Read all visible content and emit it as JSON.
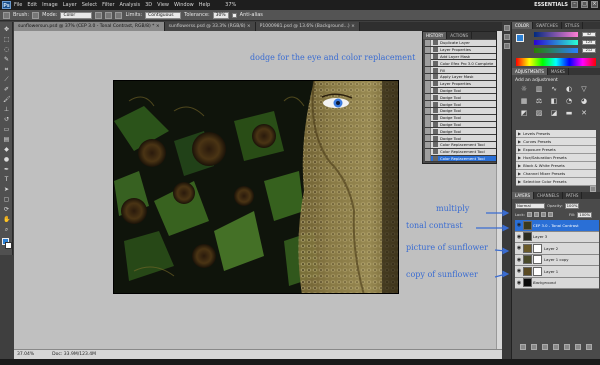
{
  "menubar": {
    "logo": "Ps",
    "items": [
      "File",
      "Edit",
      "Image",
      "Layer",
      "Select",
      "Filter",
      "Analysis",
      "3D",
      "View",
      "Window",
      "Help"
    ],
    "zoom": "37%",
    "workspace": "ESSENTIALS"
  },
  "optionsbar": {
    "brush_label": "Brush:",
    "mode_label": "Mode:",
    "mode_value": "Color",
    "limits_label": "Limits:",
    "limits_value": "Contiguous",
    "tolerance_label": "Tolerance:",
    "tolerance_value": "30%",
    "antialias_label": "Anti-alias"
  },
  "tabs": [
    {
      "label": "sunflowersun.psd @ 37% (CEP 3.0 - Tonal Contrast, RGB/8) *",
      "close": "×"
    },
    {
      "label": "sunflowerss.psd @ 33.3% (RGB/8)",
      "close": "×"
    },
    {
      "label": "P1000981.psd @ 13.6% (Background...)",
      "close": "×"
    }
  ],
  "statusbar": {
    "zoom": "37.04%",
    "doc": "Doc: 33.9M/123.4M"
  },
  "history": {
    "tabs": [
      "HISTORY",
      "ACTIONS"
    ],
    "items": [
      "Duplicate Layer",
      "Layer Properties",
      "Add Layer Mask",
      "Color Efex Pro 3.0 Complete",
      "Fill",
      "Apply Layer Mask",
      "Layer Properties",
      "Dodge Tool",
      "Dodge Tool",
      "Dodge Tool",
      "Dodge Tool",
      "Dodge Tool",
      "Dodge Tool",
      "Dodge Tool",
      "Dodge Tool",
      "Color Replacement Tool",
      "Color Replacement Tool",
      "Color Replacement Tool"
    ],
    "selected_index": 17
  },
  "color_panel": {
    "tabs": [
      "COLOR",
      "SWATCHES",
      "STYLES"
    ],
    "r": "42",
    "g": "125",
    "b": "212",
    "fg_color": "#2a7fd4",
    "bg_color": "#ffffff"
  },
  "adjustments": {
    "tabs": [
      "ADJUSTMENTS",
      "MASKS"
    ],
    "title": "Add an adjustment",
    "presets": [
      "Levels Presets",
      "Curves Presets",
      "Exposure Presets",
      "Hue/Saturation Presets",
      "Black & White Presets",
      "Channel Mixer Presets",
      "Selective Color Presets"
    ]
  },
  "layers": {
    "tabs": [
      "LAYERS",
      "CHANNELS",
      "PATHS"
    ],
    "blend_mode": "Normal",
    "opacity_label": "Opacity:",
    "opacity_value": "100%",
    "lock_label": "Lock:",
    "fill_label": "Fill:",
    "fill_value": "100%",
    "items": [
      {
        "name": "CEP 3.0 - Tonal Contrast",
        "has_mask": false
      },
      {
        "name": "Layer 3",
        "has_mask": false
      },
      {
        "name": "Layer 2",
        "has_mask": true
      },
      {
        "name": "Layer 1 copy",
        "has_mask": true
      },
      {
        "name": "Layer 1",
        "has_mask": true
      },
      {
        "name": "Background",
        "has_mask": false
      }
    ],
    "selected_index": 0
  },
  "annotations": {
    "dodge": "dodge for the eye and color replacement",
    "multiply": "multiply",
    "tonal": "tonal contrast",
    "picture": "picture of sunflower",
    "copy": "copy of sunflower"
  },
  "colors": {
    "annotation": "#3a6cd1",
    "selection": "#2a6fd6"
  }
}
